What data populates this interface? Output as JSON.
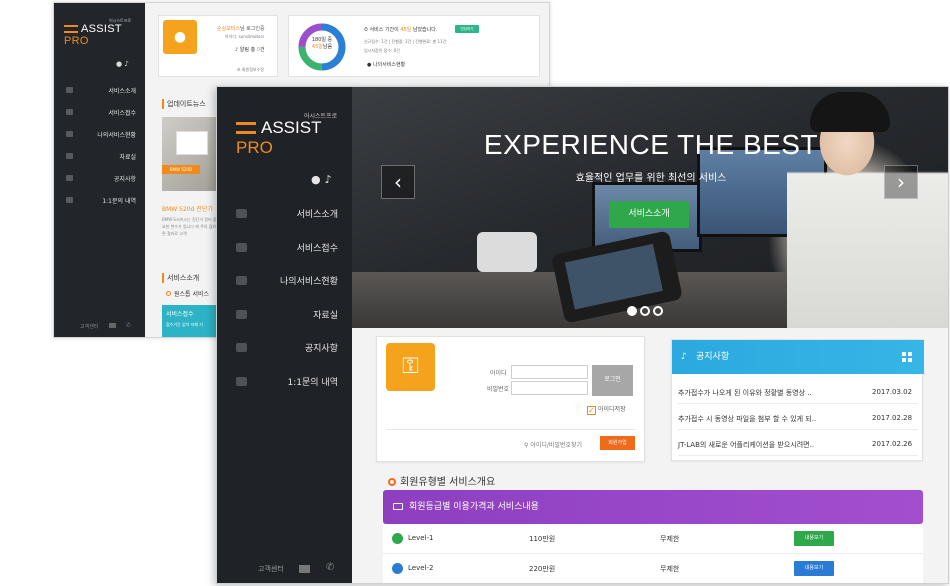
{
  "back": {
    "logo_sub": "어시스트프로",
    "logo_main": "ASSIST",
    "logo_pro": "PRO",
    "menu": [
      {
        "label": "서비스소개",
        "icon": "pin-icon"
      },
      {
        "label": "서비스접수",
        "icon": "list-icon"
      },
      {
        "label": "나의서비스현황",
        "icon": "user-circle-icon"
      },
      {
        "label": "자료실",
        "icon": "book-icon"
      },
      {
        "label": "공지사항",
        "icon": "bell-icon"
      },
      {
        "label": "1:1문의 내역",
        "icon": "chat-icon"
      }
    ],
    "footer_label": "고객센터",
    "card1": {
      "user_name": "순실모터스",
      "greeting_suffix": "님 로그인중",
      "id_text": "아이디: sunsilmotors",
      "alert_prefix": "알림 총 ",
      "alert_count": "0",
      "alert_suffix": "건",
      "info_link": "회원정보수정"
    },
    "card2": {
      "donut_total": "180일 중",
      "donut_left": "45일",
      "donut_left_suffix": "남음",
      "period_prefix": "서비스 기간이 ",
      "period_value": "45일",
      "period_suffix": " 남았습니다.",
      "extend_button": "연장하기",
      "stats_line1": "신규접수: 1건  |  진행중: 2건  |  진행완료: 총 11건",
      "stats_line2": "임시저장된 접수: 0건",
      "my_status": "나의서비스현황"
    },
    "news_heading": "업데이트뉴스",
    "news_tag": "BMW 520D",
    "news_title": "BMW 520d 진단기",
    "news_desc": "BMW-S서비스는 진단기 정비 중요한 변수가 됩니다 에 주의 많으면 결과로 고객",
    "service_heading": "서비스소개",
    "service_sub": "원스톱 서비스",
    "service_box_title": "서비스접수",
    "service_box_desc": "접수기간 없이 자체 기"
  },
  "front": {
    "logo_sub": "어시스트프로",
    "logo_main": "ASSIST",
    "logo_pro": "PRO",
    "menu": [
      {
        "label": "서비스소개",
        "icon": "pin-icon"
      },
      {
        "label": "서비스접수",
        "icon": "list-icon"
      },
      {
        "label": "나의서비스현황",
        "icon": "user-circle-icon"
      },
      {
        "label": "자료실",
        "icon": "book-icon"
      },
      {
        "label": "공지사항",
        "icon": "bell-icon"
      },
      {
        "label": "1:1문의 내역",
        "icon": "chat-icon"
      }
    ],
    "footer_label": "고객센터",
    "hero": {
      "title": "EXPERIENCE THE BEST",
      "subtitle": "효율적인 업무를 위한 최선의 서비스",
      "button": "서비스소개",
      "prev": "‹",
      "next": "›",
      "slides_count": 3,
      "active_slide": 1
    },
    "login": {
      "id_label": "아이디",
      "pw_label": "비밀번호",
      "id_value": "",
      "pw_value": "",
      "login_button": "로그인",
      "save_id": "아이디저장",
      "save_checked": true,
      "find_link": "아이디/비밀번호찾기",
      "join_button": "회원가입"
    },
    "notice": {
      "title": "공지사항",
      "items": [
        {
          "title": "추가접수가 나오게 된 이유와 정황별 동영상 ..",
          "date": "2017.03.02"
        },
        {
          "title": "추가접수 시 동영상 파일을 첨부 할 수 있게 되..",
          "date": "2017.02.28"
        },
        {
          "title": "JT-LAB의 새로운 어플리케이션을 받으시려면..",
          "date": "2017.02.26"
        }
      ]
    },
    "section_title": "회원유형별 서비스개요",
    "pricing_header": "회원등급별 이용가격과 서비스내용",
    "pricing_rows": [
      {
        "level": "Level-1",
        "price": "110만원",
        "limit": "무제한",
        "button": "내용보기",
        "color": "#2ea84a"
      },
      {
        "level": "Level-2",
        "price": "220만원",
        "limit": "무제한",
        "button": "내용보기",
        "color": "#2a7bd6"
      }
    ]
  },
  "colors": {
    "accent_orange": "#f08a1c",
    "sidebar_dark": "#1f2227",
    "notice_blue": "#2ba9e0",
    "purple": "#8d3fc0",
    "green": "#2ea84a",
    "blue": "#2a7bd6"
  }
}
